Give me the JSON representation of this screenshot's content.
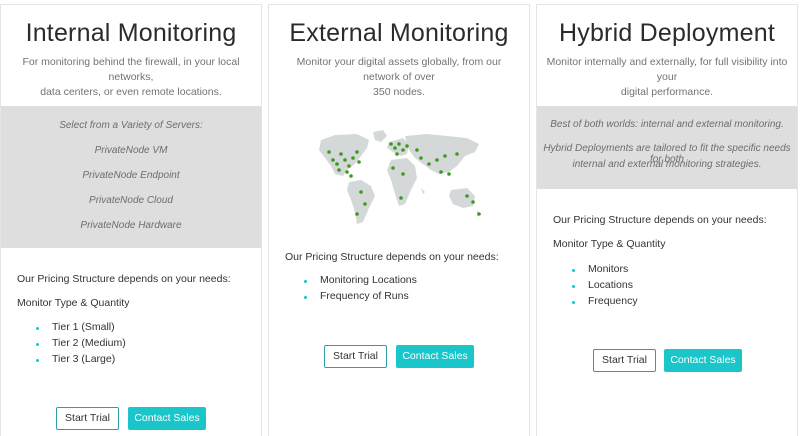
{
  "colors": {
    "accent": "#1ac6c9",
    "grey_band": "#dedede",
    "map_land": "#d5d8d9",
    "map_marker": "#3c9b1e"
  },
  "cards": [
    {
      "title": "Internal Monitoring",
      "description": [
        "For monitoring behind the firewall, in your local networks,",
        "data centers, or even remote locations."
      ],
      "features": [
        "Select from a Variety of Servers:",
        "PrivateNode VM",
        "PrivateNode Endpoint",
        "PrivateNode Cloud",
        "PrivateNode Hardware"
      ],
      "pricing_text": "Our Pricing Structure depends on your needs:",
      "sub_heading": "Monitor Type & Quantity",
      "bullets": [
        "Tier 1 (Small)",
        "Tier 2 (Medium)",
        "Tier 3 (Large)"
      ],
      "trial_label": "Start Trial",
      "sales_label": "Contact Sales"
    },
    {
      "title": "External Monitoring",
      "description": [
        "Monitor your digital assets globally, from our network of over",
        "350 nodes."
      ],
      "map_icon": "world-map-icon",
      "pricing_text": "Our Pricing Structure depends on your needs:",
      "bullets": [
        "Monitoring Locations",
        "Frequency of Runs"
      ],
      "trial_label": "Start Trial",
      "sales_label": "Contact Sales"
    },
    {
      "title": "Hybrid Deployment",
      "description": [
        "Monitor internally and externally, for full visibility into your",
        "digital performance."
      ],
      "features": [
        "Best of both worlds: internal and external monitoring.",
        "Hybrid Deployments are tailored to fit the specific needs for both",
        "internal and external monitoring strategies."
      ],
      "pricing_text": "Our Pricing Structure depends on your needs:",
      "sub_heading": "Monitor Type & Quantity",
      "bullets": [
        "Monitors",
        "Locations",
        "Frequency"
      ],
      "trial_label": "Start Trial",
      "sales_label": "Contact Sales"
    }
  ]
}
